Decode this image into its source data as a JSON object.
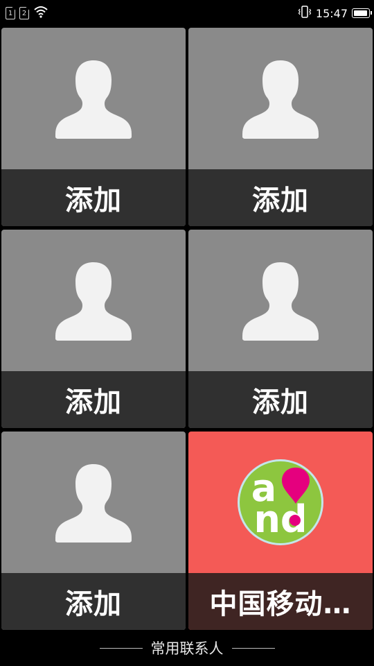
{
  "status_bar": {
    "sim1": "1",
    "sim2": "2",
    "time": "15:47",
    "battery_level": 0.95,
    "icons": [
      "sim1-icon",
      "sim2-icon",
      "wifi-icon",
      "vibrate-icon",
      "battery-icon"
    ]
  },
  "tiles": [
    {
      "label": "添加",
      "type": "empty"
    },
    {
      "label": "添加",
      "type": "empty"
    },
    {
      "label": "添加",
      "type": "empty"
    },
    {
      "label": "添加",
      "type": "empty"
    },
    {
      "label": "添加",
      "type": "empty"
    },
    {
      "label": "中国移动…",
      "type": "contact",
      "avatar_text_top": "a",
      "avatar_text_bottom": "nd"
    }
  ],
  "footer": {
    "title": "常用联系人"
  },
  "colors": {
    "background": "#000000",
    "tile_gray": "#8a8a8a",
    "label_bar": "#303030",
    "mobile_tile": "#f45a56",
    "mobile_label_bar": "#3f2523",
    "logo_green": "#8dc63f",
    "logo_pink": "#e5007e"
  }
}
